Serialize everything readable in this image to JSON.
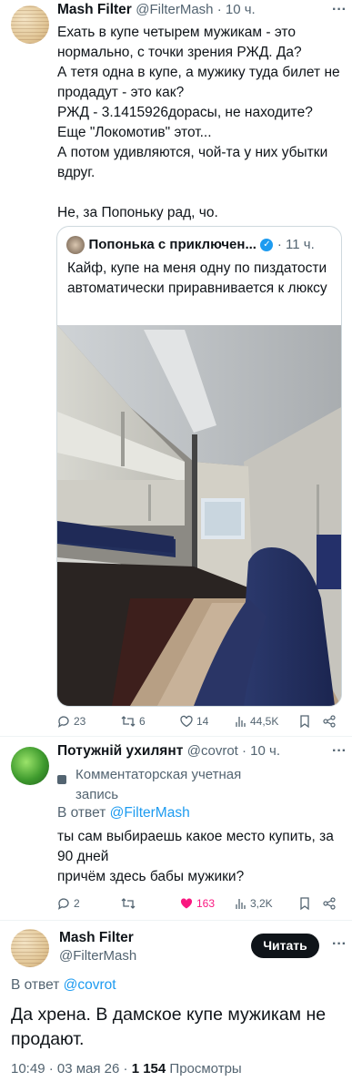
{
  "tweet1": {
    "author_name": "Mash Filter",
    "handle_time": "@FilterMash · 10 ч.",
    "text": "Ехать в купе четырем мужикам - это нормально, с точки зрения РЖД. Да?\nА тетя одна в купе, а мужику туда билет не продадут - это как?\nРЖД - 3.1415926дорасы, не находите?\nЕще \"Локомотив\" этот...\nА потом удивляются, чой-та у них убытки вдруг.\n\nНе, за Попоньку рад, чо.",
    "quote": {
      "author_name": "Попонька с приключен...",
      "time": "· 11 ч.",
      "text": "Кайф, купе на меня одну по пиздатости автоматически приравнивается к люксу"
    },
    "stats": {
      "replies": "23",
      "retweets": "6",
      "likes": "14",
      "views": "44,5K"
    }
  },
  "tweet2": {
    "author_name": "Потужній ухилянт",
    "handle_time": "@covrot · 10 ч.",
    "account_label": "Комментаторская учетная запись",
    "reply_prefix": "В ответ",
    "reply_to": "@FilterMash",
    "text": "ты сам выбираешь какое место купить, за 90 дней\nпричём здесь бабы мужики?",
    "stats": {
      "replies": "2",
      "retweets": "",
      "likes": "163",
      "views": "3,2K"
    }
  },
  "tweet3": {
    "author_name": "Mash Filter",
    "handle": "@FilterMash",
    "follow_button": "Читать",
    "reply_prefix": "В ответ",
    "reply_to": "@covrot",
    "text": "Да хрена. В дамское купе мужикам не продают.",
    "time_date": "10:49 · 03 мая 26 ·",
    "views_count": "1 154",
    "views_label": "Просмотры"
  },
  "colors": {
    "accent": "#1d9bf0",
    "like": "#f91880",
    "text": "#0f1419",
    "secondary": "#536471"
  },
  "icons": [
    "reply-icon",
    "retweet-icon",
    "heart-icon",
    "views-icon",
    "bookmark-icon",
    "share-icon",
    "verified-icon",
    "commentator-badge-icon"
  ]
}
